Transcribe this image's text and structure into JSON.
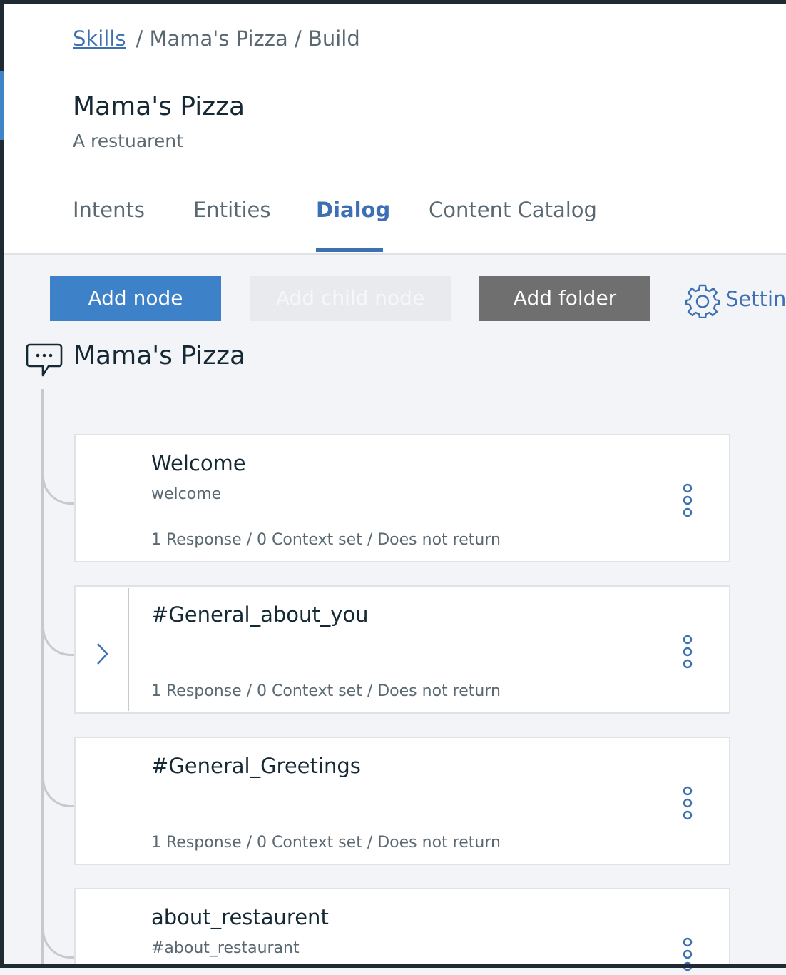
{
  "breadcrumb": {
    "root": "Skills",
    "skill": "Mama's Pizza",
    "page": "Build",
    "separator": "/"
  },
  "skill": {
    "title": "Mama's Pizza",
    "description": "A restuarent"
  },
  "tabs": [
    {
      "label": "Intents",
      "active": false
    },
    {
      "label": "Entities",
      "active": false
    },
    {
      "label": "Dialog",
      "active": true
    },
    {
      "label": "Content Catalog",
      "active": false
    }
  ],
  "toolbar": {
    "add_node": "Add node",
    "add_child_node": "Add child node",
    "add_folder": "Add folder",
    "settings": "Settin"
  },
  "tree": {
    "root_label": "Mama's Pizza",
    "root_icon": "chat-bubble-icon",
    "nodes": [
      {
        "title": "Welcome",
        "condition": "welcome",
        "meta": "1 Response / 0 Context set / Does not return",
        "has_children": false
      },
      {
        "title": "#General_about_you",
        "condition": "",
        "meta": "1 Response / 0 Context set / Does not return",
        "has_children": true
      },
      {
        "title": "#General_Greetings",
        "condition": "",
        "meta": "1 Response / 0 Context set / Does not return",
        "has_children": false
      },
      {
        "title": "about_restaurent",
        "condition": "#about_restaurant",
        "meta": "",
        "has_children": false
      }
    ]
  },
  "colors": {
    "accent": "#3d70b2",
    "primary_button": "#3d81c8",
    "folder_button": "#6f6f6f",
    "disabled_button": "#e8eaed",
    "background": "#f3f4f7"
  }
}
